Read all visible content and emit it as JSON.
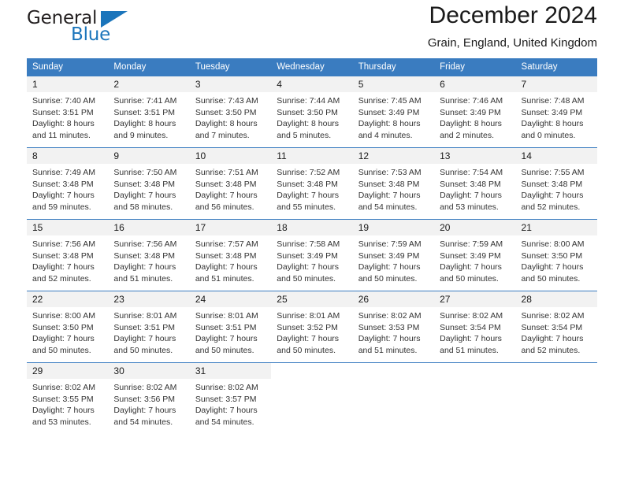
{
  "brand": {
    "name_part1": "General",
    "name_part2": "Blue",
    "triangle_color": "#1b75bb"
  },
  "header": {
    "title": "December 2024",
    "location": "Grain, England, United Kingdom",
    "header_bg_color": "#3a7cc0",
    "daynum_bg_color": "#f2f2f2"
  },
  "weekday_headers": [
    "Sunday",
    "Monday",
    "Tuesday",
    "Wednesday",
    "Thursday",
    "Friday",
    "Saturday"
  ],
  "labels": {
    "sunrise_prefix": "Sunrise:",
    "sunset_prefix": "Sunset:",
    "daylight_prefix": "Daylight:"
  },
  "weeks": [
    [
      {
        "day": "1",
        "sunrise": "Sunrise: 7:40 AM",
        "sunset": "Sunset: 3:51 PM",
        "daylight_line1": "Daylight: 8 hours",
        "daylight_line2": "and 11 minutes."
      },
      {
        "day": "2",
        "sunrise": "Sunrise: 7:41 AM",
        "sunset": "Sunset: 3:51 PM",
        "daylight_line1": "Daylight: 8 hours",
        "daylight_line2": "and 9 minutes."
      },
      {
        "day": "3",
        "sunrise": "Sunrise: 7:43 AM",
        "sunset": "Sunset: 3:50 PM",
        "daylight_line1": "Daylight: 8 hours",
        "daylight_line2": "and 7 minutes."
      },
      {
        "day": "4",
        "sunrise": "Sunrise: 7:44 AM",
        "sunset": "Sunset: 3:50 PM",
        "daylight_line1": "Daylight: 8 hours",
        "daylight_line2": "and 5 minutes."
      },
      {
        "day": "5",
        "sunrise": "Sunrise: 7:45 AM",
        "sunset": "Sunset: 3:49 PM",
        "daylight_line1": "Daylight: 8 hours",
        "daylight_line2": "and 4 minutes."
      },
      {
        "day": "6",
        "sunrise": "Sunrise: 7:46 AM",
        "sunset": "Sunset: 3:49 PM",
        "daylight_line1": "Daylight: 8 hours",
        "daylight_line2": "and 2 minutes."
      },
      {
        "day": "7",
        "sunrise": "Sunrise: 7:48 AM",
        "sunset": "Sunset: 3:49 PM",
        "daylight_line1": "Daylight: 8 hours",
        "daylight_line2": "and 0 minutes."
      }
    ],
    [
      {
        "day": "8",
        "sunrise": "Sunrise: 7:49 AM",
        "sunset": "Sunset: 3:48 PM",
        "daylight_line1": "Daylight: 7 hours",
        "daylight_line2": "and 59 minutes."
      },
      {
        "day": "9",
        "sunrise": "Sunrise: 7:50 AM",
        "sunset": "Sunset: 3:48 PM",
        "daylight_line1": "Daylight: 7 hours",
        "daylight_line2": "and 58 minutes."
      },
      {
        "day": "10",
        "sunrise": "Sunrise: 7:51 AM",
        "sunset": "Sunset: 3:48 PM",
        "daylight_line1": "Daylight: 7 hours",
        "daylight_line2": "and 56 minutes."
      },
      {
        "day": "11",
        "sunrise": "Sunrise: 7:52 AM",
        "sunset": "Sunset: 3:48 PM",
        "daylight_line1": "Daylight: 7 hours",
        "daylight_line2": "and 55 minutes."
      },
      {
        "day": "12",
        "sunrise": "Sunrise: 7:53 AM",
        "sunset": "Sunset: 3:48 PM",
        "daylight_line1": "Daylight: 7 hours",
        "daylight_line2": "and 54 minutes."
      },
      {
        "day": "13",
        "sunrise": "Sunrise: 7:54 AM",
        "sunset": "Sunset: 3:48 PM",
        "daylight_line1": "Daylight: 7 hours",
        "daylight_line2": "and 53 minutes."
      },
      {
        "day": "14",
        "sunrise": "Sunrise: 7:55 AM",
        "sunset": "Sunset: 3:48 PM",
        "daylight_line1": "Daylight: 7 hours",
        "daylight_line2": "and 52 minutes."
      }
    ],
    [
      {
        "day": "15",
        "sunrise": "Sunrise: 7:56 AM",
        "sunset": "Sunset: 3:48 PM",
        "daylight_line1": "Daylight: 7 hours",
        "daylight_line2": "and 52 minutes."
      },
      {
        "day": "16",
        "sunrise": "Sunrise: 7:56 AM",
        "sunset": "Sunset: 3:48 PM",
        "daylight_line1": "Daylight: 7 hours",
        "daylight_line2": "and 51 minutes."
      },
      {
        "day": "17",
        "sunrise": "Sunrise: 7:57 AM",
        "sunset": "Sunset: 3:48 PM",
        "daylight_line1": "Daylight: 7 hours",
        "daylight_line2": "and 51 minutes."
      },
      {
        "day": "18",
        "sunrise": "Sunrise: 7:58 AM",
        "sunset": "Sunset: 3:49 PM",
        "daylight_line1": "Daylight: 7 hours",
        "daylight_line2": "and 50 minutes."
      },
      {
        "day": "19",
        "sunrise": "Sunrise: 7:59 AM",
        "sunset": "Sunset: 3:49 PM",
        "daylight_line1": "Daylight: 7 hours",
        "daylight_line2": "and 50 minutes."
      },
      {
        "day": "20",
        "sunrise": "Sunrise: 7:59 AM",
        "sunset": "Sunset: 3:49 PM",
        "daylight_line1": "Daylight: 7 hours",
        "daylight_line2": "and 50 minutes."
      },
      {
        "day": "21",
        "sunrise": "Sunrise: 8:00 AM",
        "sunset": "Sunset: 3:50 PM",
        "daylight_line1": "Daylight: 7 hours",
        "daylight_line2": "and 50 minutes."
      }
    ],
    [
      {
        "day": "22",
        "sunrise": "Sunrise: 8:00 AM",
        "sunset": "Sunset: 3:50 PM",
        "daylight_line1": "Daylight: 7 hours",
        "daylight_line2": "and 50 minutes."
      },
      {
        "day": "23",
        "sunrise": "Sunrise: 8:01 AM",
        "sunset": "Sunset: 3:51 PM",
        "daylight_line1": "Daylight: 7 hours",
        "daylight_line2": "and 50 minutes."
      },
      {
        "day": "24",
        "sunrise": "Sunrise: 8:01 AM",
        "sunset": "Sunset: 3:51 PM",
        "daylight_line1": "Daylight: 7 hours",
        "daylight_line2": "and 50 minutes."
      },
      {
        "day": "25",
        "sunrise": "Sunrise: 8:01 AM",
        "sunset": "Sunset: 3:52 PM",
        "daylight_line1": "Daylight: 7 hours",
        "daylight_line2": "and 50 minutes."
      },
      {
        "day": "26",
        "sunrise": "Sunrise: 8:02 AM",
        "sunset": "Sunset: 3:53 PM",
        "daylight_line1": "Daylight: 7 hours",
        "daylight_line2": "and 51 minutes."
      },
      {
        "day": "27",
        "sunrise": "Sunrise: 8:02 AM",
        "sunset": "Sunset: 3:54 PM",
        "daylight_line1": "Daylight: 7 hours",
        "daylight_line2": "and 51 minutes."
      },
      {
        "day": "28",
        "sunrise": "Sunrise: 8:02 AM",
        "sunset": "Sunset: 3:54 PM",
        "daylight_line1": "Daylight: 7 hours",
        "daylight_line2": "and 52 minutes."
      }
    ],
    [
      {
        "day": "29",
        "sunrise": "Sunrise: 8:02 AM",
        "sunset": "Sunset: 3:55 PM",
        "daylight_line1": "Daylight: 7 hours",
        "daylight_line2": "and 53 minutes."
      },
      {
        "day": "30",
        "sunrise": "Sunrise: 8:02 AM",
        "sunset": "Sunset: 3:56 PM",
        "daylight_line1": "Daylight: 7 hours",
        "daylight_line2": "and 54 minutes."
      },
      {
        "day": "31",
        "sunrise": "Sunrise: 8:02 AM",
        "sunset": "Sunset: 3:57 PM",
        "daylight_line1": "Daylight: 7 hours",
        "daylight_line2": "and 54 minutes."
      },
      {
        "day": "",
        "sunrise": "",
        "sunset": "",
        "daylight_line1": "",
        "daylight_line2": ""
      },
      {
        "day": "",
        "sunrise": "",
        "sunset": "",
        "daylight_line1": "",
        "daylight_line2": ""
      },
      {
        "day": "",
        "sunrise": "",
        "sunset": "",
        "daylight_line1": "",
        "daylight_line2": ""
      },
      {
        "day": "",
        "sunrise": "",
        "sunset": "",
        "daylight_line1": "",
        "daylight_line2": ""
      }
    ]
  ]
}
